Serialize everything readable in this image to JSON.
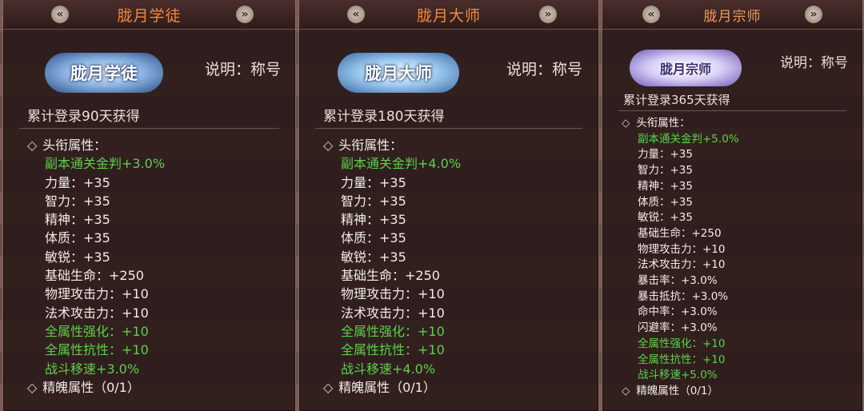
{
  "panels": [
    {
      "title": "胧月学徒",
      "badge_text": "胧月学徒",
      "description": "说明：称号",
      "acquire": "累计登录90天获得",
      "header": "头衔属性：",
      "attributes": [
        {
          "text": "副本通关金判+3.0%",
          "green": true
        },
        {
          "text": "力量：+35",
          "green": false
        },
        {
          "text": "智力：+35",
          "green": false
        },
        {
          "text": "精神：+35",
          "green": false
        },
        {
          "text": "体质：+35",
          "green": false
        },
        {
          "text": "敏锐：+35",
          "green": false
        },
        {
          "text": "基础生命：+250",
          "green": false
        },
        {
          "text": "物理攻击力：+10",
          "green": false
        },
        {
          "text": "法术攻击力：+10",
          "green": false
        },
        {
          "text": "全属性强化：+10",
          "green": true
        },
        {
          "text": "全属性抗性：+10",
          "green": true
        },
        {
          "text": "战斗移速+3.0%",
          "green": true
        }
      ],
      "footer": "精魄属性（0/1）"
    },
    {
      "title": "胧月大师",
      "badge_text": "胧月大师",
      "description": "说明：称号",
      "acquire": "累计登录180天获得",
      "header": "头衔属性：",
      "attributes": [
        {
          "text": "副本通关金判+4.0%",
          "green": true
        },
        {
          "text": "力量：+35",
          "green": false
        },
        {
          "text": "智力：+35",
          "green": false
        },
        {
          "text": "精神：+35",
          "green": false
        },
        {
          "text": "体质：+35",
          "green": false
        },
        {
          "text": "敏锐：+35",
          "green": false
        },
        {
          "text": "基础生命：+250",
          "green": false
        },
        {
          "text": "物理攻击力：+10",
          "green": false
        },
        {
          "text": "法术攻击力：+10",
          "green": false
        },
        {
          "text": "全属性强化：+10",
          "green": true
        },
        {
          "text": "全属性抗性：+10",
          "green": true
        },
        {
          "text": "战斗移速+4.0%",
          "green": true
        }
      ],
      "footer": "精魄属性（0/1）"
    },
    {
      "title": "胧月宗师",
      "badge_text": "胧月宗师",
      "description": "说明：称号",
      "acquire": "累计登录365天获得",
      "header": "头衔属性：",
      "attributes": [
        {
          "text": "副本通关金判+5.0%",
          "green": true
        },
        {
          "text": "力量：+35",
          "green": false
        },
        {
          "text": "智力：+35",
          "green": false
        },
        {
          "text": "精神：+35",
          "green": false
        },
        {
          "text": "体质：+35",
          "green": false
        },
        {
          "text": "敏锐：+35",
          "green": false
        },
        {
          "text": "基础生命：+250",
          "green": false
        },
        {
          "text": "物理攻击力：+10",
          "green": false
        },
        {
          "text": "法术攻击力：+10",
          "green": false
        },
        {
          "text": "暴击率：+3.0%",
          "green": false
        },
        {
          "text": "暴击抵抗：+3.0%",
          "green": false
        },
        {
          "text": "命中率：+3.0%",
          "green": false
        },
        {
          "text": "闪避率：+3.0%",
          "green": false
        },
        {
          "text": "全属性强化：+10",
          "green": true
        },
        {
          "text": "全属性抗性：+10",
          "green": true
        },
        {
          "text": "战斗移速+5.0%",
          "green": true
        }
      ],
      "footer": "精魄属性（0/1）"
    }
  ],
  "nav": {
    "prev_glyph": "«",
    "next_glyph": "»"
  },
  "diamond_glyph": "◇",
  "colors": {
    "title": "#f08a3c",
    "green": "#5cd04a",
    "text": "#f1ece6",
    "panel_bg": "#2e1c1b"
  }
}
